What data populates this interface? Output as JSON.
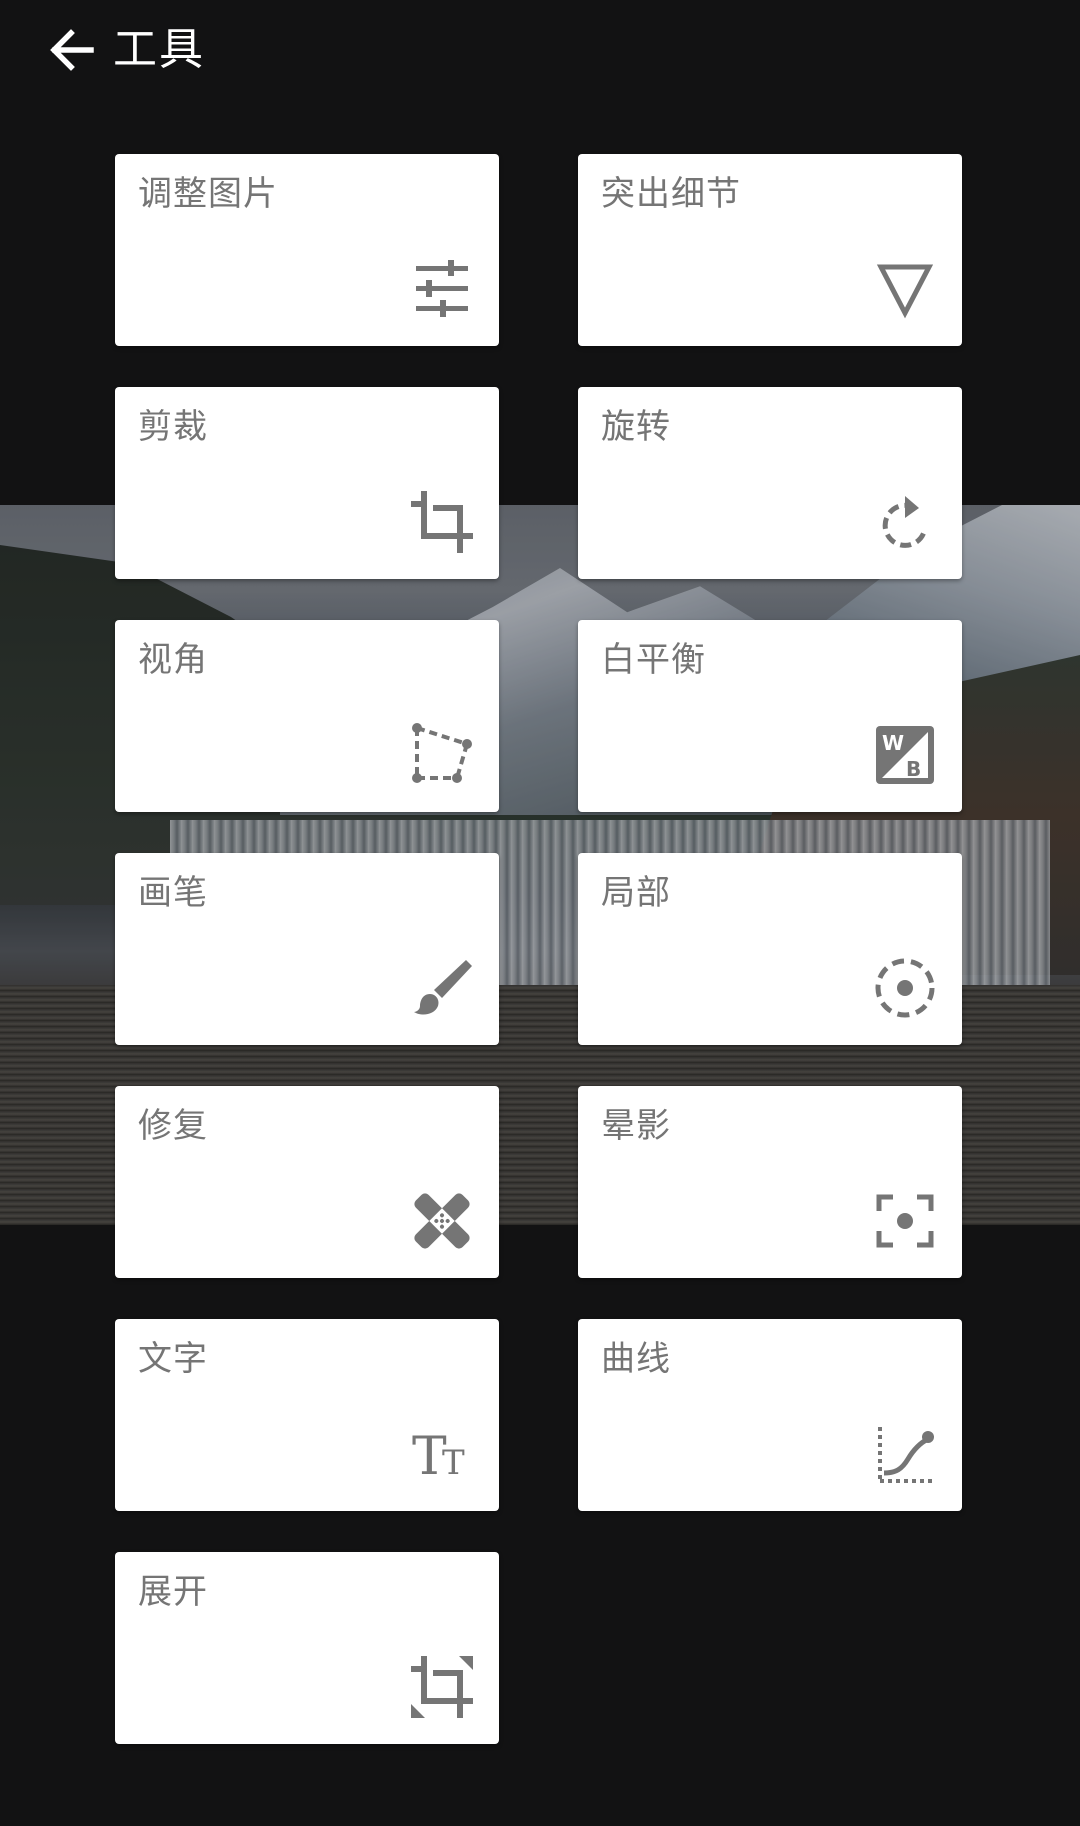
{
  "header": {
    "title": "工具",
    "back_icon": "arrow-left-icon"
  },
  "tools": [
    {
      "label": "调整图片",
      "icon": "tune-sliders-icon"
    },
    {
      "label": "突出细节",
      "icon": "details-triangle-icon"
    },
    {
      "label": "剪裁",
      "icon": "crop-icon"
    },
    {
      "label": "旋转",
      "icon": "rotate-icon"
    },
    {
      "label": "视角",
      "icon": "perspective-icon"
    },
    {
      "label": "白平衡",
      "icon": "white-balance-icon",
      "icon_text": [
        "W",
        "B"
      ]
    },
    {
      "label": "画笔",
      "icon": "brush-icon"
    },
    {
      "label": "局部",
      "icon": "selective-icon"
    },
    {
      "label": "修复",
      "icon": "healing-bandage-icon"
    },
    {
      "label": "晕影",
      "icon": "vignette-icon"
    },
    {
      "label": "文字",
      "icon": "text-icon",
      "icon_text": [
        "T",
        "T"
      ]
    },
    {
      "label": "曲线",
      "icon": "curves-icon"
    },
    {
      "label": "展开",
      "icon": "expand-icon"
    }
  ],
  "colors": {
    "background": "#121213",
    "tile": "#ffffff",
    "tile_text": "#757575",
    "icon": "#757575",
    "header_text": "#ffffff"
  }
}
